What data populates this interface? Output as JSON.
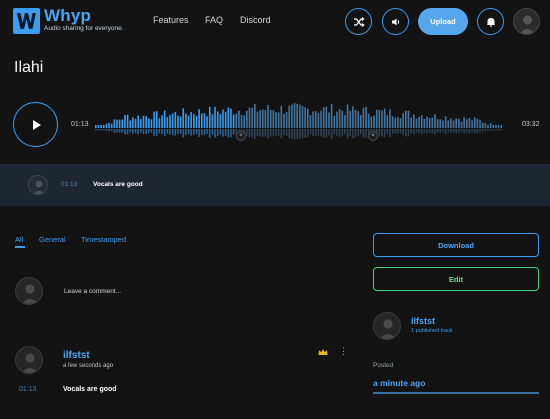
{
  "app": {
    "name": "Whyp",
    "tagline": "Audio sharing for everyone.",
    "accent_color": "#3b9cf0"
  },
  "nav": {
    "links": [
      "Features",
      "FAQ",
      "Discord"
    ],
    "upload_label": "Upload",
    "icons": [
      "shuffle-icon",
      "volume-icon",
      "bell-icon"
    ]
  },
  "track": {
    "title": "Ilahi",
    "current_time": "01:13",
    "total_time": "03:32",
    "progress": 0.344
  },
  "featured_comment": {
    "timestamp": "01:13",
    "text": "Vocals are good"
  },
  "tabs": [
    "All",
    "General",
    "Timestamped"
  ],
  "compose": {
    "placeholder": "Leave a comment..."
  },
  "comment": {
    "author": "ilfstst",
    "time_ago": "a few seconds ago",
    "timestamp": "01:13",
    "text": "Vocals are good"
  },
  "sidebar": {
    "download_label": "Download",
    "edit_label": "Edit",
    "uploader_name": "ilfstst",
    "uploader_tracks": "1 published track",
    "posted_label": "Posted",
    "posted_value": "a minute ago"
  }
}
